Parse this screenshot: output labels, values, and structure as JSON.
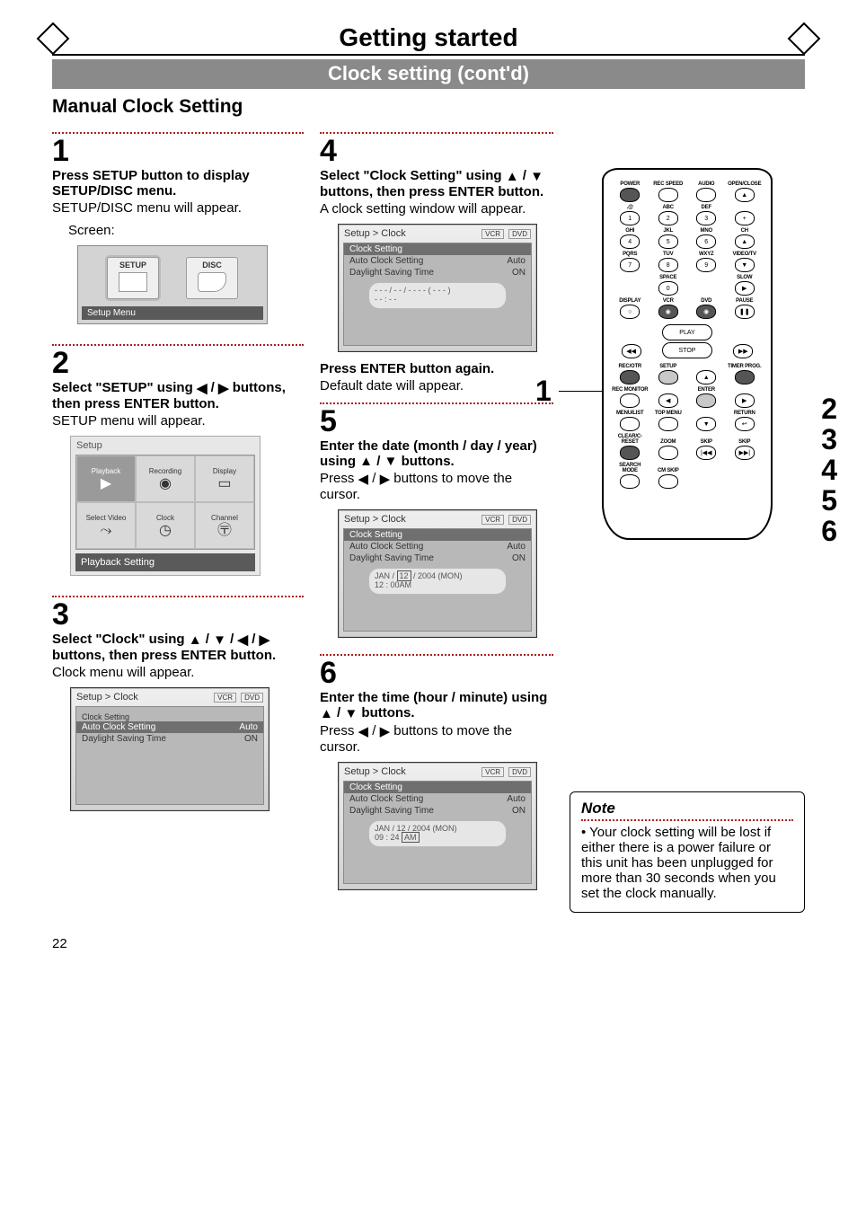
{
  "header": {
    "title": "Getting started",
    "subtitle": "Clock setting (cont'd)"
  },
  "section_heading": "Manual Clock Setting",
  "icons": {
    "up": "▲",
    "down": "▼",
    "left": "◀",
    "right": "▶"
  },
  "steps": {
    "s1": {
      "num": "1",
      "head": "Press SETUP button to display SETUP/DISC menu.",
      "body": "SETUP/DISC menu will appear.",
      "screen_label": "Screen:",
      "screen": {
        "setup_label": "SETUP",
        "disc_label": "DISC",
        "caption": "Setup Menu"
      }
    },
    "s2": {
      "num": "2",
      "head_pre": "Select \"SETUP\" using ",
      "head_post": " buttons, then press ENTER button.",
      "body": "SETUP menu will appear.",
      "screen": {
        "title": "Setup",
        "cells": [
          "Playback",
          "Recording",
          "Display",
          "Select Video",
          "Clock",
          "Channel"
        ],
        "caption": "Playback Setting"
      }
    },
    "s3": {
      "num": "3",
      "head_pre": "Select \"Clock\" using ",
      "head_post": " buttons, then press ENTER button.",
      "body": "Clock menu will appear.",
      "screen": {
        "breadcrumb": "Setup > Clock",
        "tags": [
          "VCR",
          "DVD"
        ],
        "row1": "Clock Setting",
        "row2l": "Auto Clock Setting",
        "row2r": "Auto",
        "row3l": "Daylight Saving Time",
        "row3r": "ON"
      }
    },
    "s4": {
      "num": "4",
      "head_pre": "Select \"Clock Setting\" using ",
      "head_post": " buttons, then press ENTER button.",
      "body": "A clock setting window will appear.",
      "screen": {
        "breadcrumb": "Setup > Clock",
        "tags": [
          "VCR",
          "DVD"
        ],
        "row1": "Clock Setting",
        "row2l": "Auto Clock Setting",
        "row2r": "Auto",
        "row3l": "Daylight Saving Time",
        "row3r": "ON",
        "clock_line1": "- - - / - - / - - - -  ( - - - )",
        "clock_line2": "- - : - -"
      },
      "second_head": "Press ENTER button again.",
      "second_body": "Default date will appear."
    },
    "s5": {
      "num": "5",
      "head_pre": "Enter the date (month / day / year) using ",
      "head_post": " buttons.",
      "body_pre": "Press ",
      "body_post": " buttons to move the cursor.",
      "screen": {
        "breadcrumb": "Setup > Clock",
        "tags": [
          "VCR",
          "DVD"
        ],
        "row1": "Clock Setting",
        "row2l": "Auto Clock Setting",
        "row2r": "Auto",
        "row3l": "Daylight Saving Time",
        "row3r": "ON",
        "clock_line1_pre": "JAN / ",
        "clock_line1_hl": "12",
        "clock_line1_post": " / 2004 (MON)",
        "clock_line2": "12 : 00AM"
      }
    },
    "s6": {
      "num": "6",
      "head_pre": "Enter the time (hour / minute) using ",
      "head_post": " buttons.",
      "body_pre": "Press ",
      "body_post": " buttons to move the cursor.",
      "screen": {
        "breadcrumb": "Setup > Clock",
        "tags": [
          "VCR",
          "DVD"
        ],
        "row1": "Clock Setting",
        "row2l": "Auto Clock Setting",
        "row2r": "Auto",
        "row3l": "Daylight Saving Time",
        "row3r": "ON",
        "clock_line1": "JAN / 12 / 2004 (MON)",
        "clock_line2_pre": "09 : 24 ",
        "clock_line2_hl": "AM"
      }
    }
  },
  "remote": {
    "labels_row1": [
      "POWER",
      "REC SPEED",
      "AUDIO",
      "OPEN/CLOSE"
    ],
    "labels_row2": [
      ".@",
      "ABC",
      "DEF",
      ""
    ],
    "nums_row2": [
      "1",
      "2",
      "3",
      ""
    ],
    "labels_row3": [
      "GHI",
      "JKL",
      "MNO",
      "CH"
    ],
    "nums_row3": [
      "4",
      "5",
      "6",
      "▲"
    ],
    "labels_row4": [
      "PQRS",
      "TUV",
      "WXYZ",
      "VIDEO/TV"
    ],
    "nums_row4": [
      "7",
      "8",
      "9",
      "▼"
    ],
    "labels_row5": [
      "",
      "SPACE",
      "",
      "SLOW"
    ],
    "nums_row5": [
      "",
      "0",
      "",
      "▶"
    ],
    "labels_row6": [
      "DISPLAY",
      "VCR",
      "DVD",
      "PAUSE"
    ],
    "play_label": "PLAY",
    "stop_label": "STOP",
    "labels_row7": [
      "REC/OTR",
      "SETUP",
      "",
      "TIMER PROG."
    ],
    "labels_row8": [
      "REC MONITOR",
      "",
      "ENTER",
      ""
    ],
    "labels_row9": [
      "MENU/LIST",
      "TOP MENU",
      "",
      "RETURN"
    ],
    "labels_row10": [
      "CLEAR/C-RESET",
      "ZOOM",
      "SKIP",
      "SKIP"
    ],
    "labels_row11": [
      "SEARCH MODE",
      "CM SKIP",
      "",
      ""
    ]
  },
  "callouts": {
    "left": "1",
    "right": [
      "2",
      "3",
      "4",
      "5",
      "6"
    ]
  },
  "note": {
    "title": "Note",
    "body": "Your clock setting will be lost if either there is a power failure or this unit has been unplugged for more than 30 seconds when you set the clock manually."
  },
  "page_number": "22"
}
